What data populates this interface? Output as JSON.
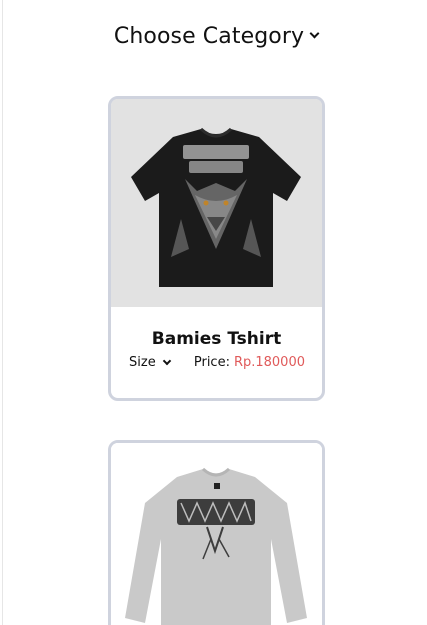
{
  "header": {
    "category_label": "Choose Category"
  },
  "products": [
    {
      "name": "Bamies Tshirt",
      "size_label": "Size",
      "price_label": "Price:",
      "price_value": "Rp.180000",
      "image": "black-tshirt-wolf-graphic"
    },
    {
      "image": "grey-longsleeve-graphic"
    }
  ],
  "colors": {
    "card_border": "#cfd3de",
    "price": "#e05a5a",
    "image_bg": "#e2e2e2"
  }
}
